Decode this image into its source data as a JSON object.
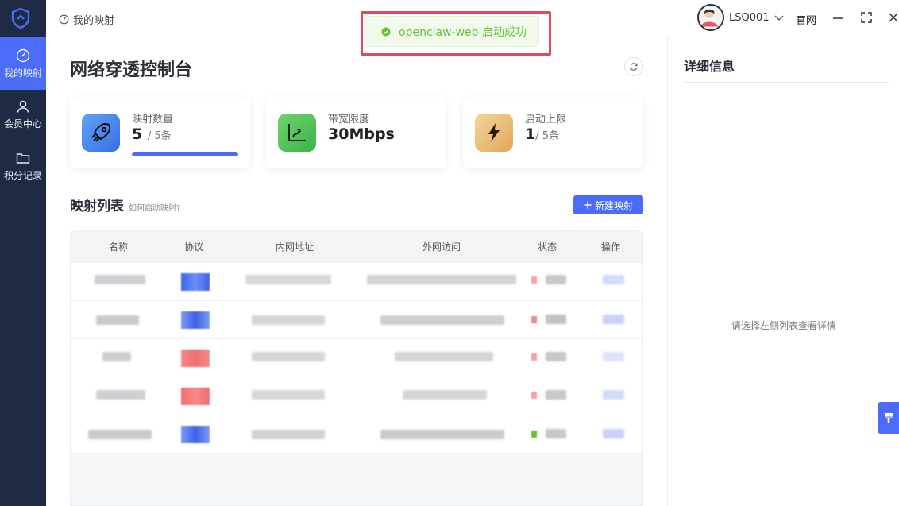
{
  "sidebar": {
    "items": [
      {
        "label": "我的映射",
        "icon": "dashboard-icon",
        "active": true
      },
      {
        "label": "会员中心",
        "icon": "user-icon",
        "active": false
      },
      {
        "label": "积分记录",
        "icon": "folder-icon",
        "active": false
      }
    ]
  },
  "topbar": {
    "breadcrumb": "我的映射",
    "username": "LSQ001",
    "official_site": "官网"
  },
  "toast": {
    "message": "openclaw-web 启动成功",
    "type": "success"
  },
  "main": {
    "title": "网络穿透控制台",
    "stats": [
      {
        "label": "映射数量",
        "value": "5",
        "unit": "/ 5条",
        "progress": 1.0,
        "icon": "rocket-icon"
      },
      {
        "label": "带宽限度",
        "value": "30Mbps",
        "unit": "",
        "icon": "chart-icon"
      },
      {
        "label": "启动上限",
        "value": "1",
        "unit": "/ 5条",
        "icon": "bolt-icon"
      }
    ],
    "list": {
      "title": "映射列表",
      "hint": "如何启动映射?",
      "new_button": "新建映射",
      "columns": [
        "名称",
        "协议",
        "内网地址",
        "外网访问",
        "状态",
        "操作"
      ]
    }
  },
  "detail": {
    "title": "详细信息",
    "empty_text": "请选择左侧列表查看详情"
  },
  "colors": {
    "sidebar_bg": "#1f2a44",
    "accent": "#4a6cf7",
    "success": "#67c23a",
    "highlight_frame": "#e04a5b"
  }
}
